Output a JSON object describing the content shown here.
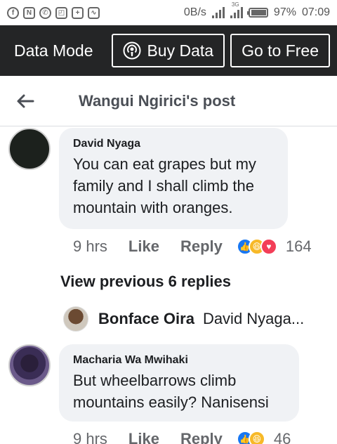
{
  "status_bar": {
    "data_rate": "0B/s",
    "network_type": "3G",
    "battery": "97%",
    "time": "07:09",
    "notification_icons": [
      "facebook-icon",
      "n-icon",
      "whatsapp-icon",
      "cast-icon",
      "plus-icon",
      "activity-icon"
    ]
  },
  "data_bar": {
    "label": "Data Mode",
    "buy_data": "Buy Data",
    "go_free": "Go to Free"
  },
  "header": {
    "title": "Wangui Ngirici's post"
  },
  "comments": [
    {
      "author": "David Nyaga",
      "text": "You can eat grapes but my family and I shall climb the mountain with oranges.",
      "time": "9 hrs",
      "like": "Like",
      "reply": "Reply",
      "reaction_count": "164",
      "reactions": [
        "like",
        "haha",
        "love"
      ]
    },
    {
      "author": "Macharia Wa Mwihaki",
      "text": "But wheelbarrows climb mountains easily? Nanisensi",
      "time": "9 hrs",
      "like": "Like",
      "reply": "Reply",
      "reaction_count": "46",
      "reactions": [
        "like",
        "haha"
      ]
    }
  ],
  "view_previous": "View previous 6 replies",
  "reply_preview": {
    "author": "Bonface Oira",
    "text": "David Nyaga..."
  },
  "colors": {
    "data_bar_bg": "#242526",
    "bubble_bg": "#f0f2f5",
    "like_blue": "#1877f2"
  }
}
